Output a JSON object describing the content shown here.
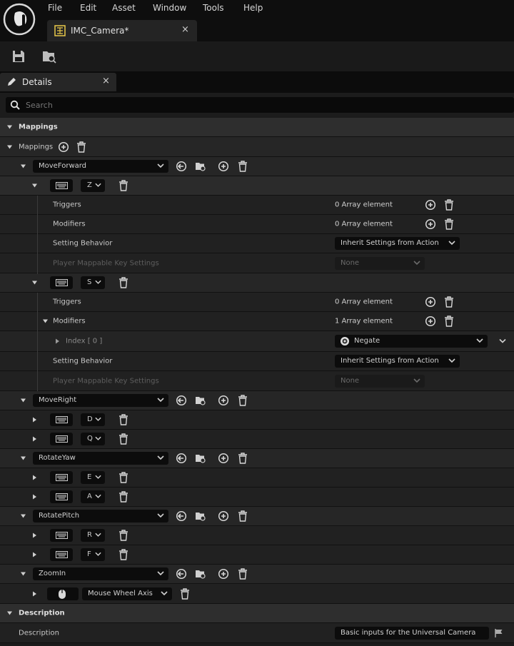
{
  "menu": [
    "File",
    "Edit",
    "Asset",
    "Window",
    "Tools",
    "Help"
  ],
  "tab": {
    "title": "IMC_Camera*"
  },
  "panel": {
    "title": "Details"
  },
  "search": {
    "placeholder": "Search"
  },
  "sections": {
    "mappings": "Mappings",
    "description": "Description"
  },
  "mappings_label": "Mappings",
  "actions": [
    "MoveForward",
    "MoveRight",
    "RotateYaw",
    "RotatePitch",
    "ZoomIn"
  ],
  "keys": {
    "z": "Z",
    "s": "S",
    "d": "D",
    "q": "Q",
    "e": "E",
    "a": "A",
    "r": "R",
    "f": "F",
    "wheel": "Mouse Wheel Axis"
  },
  "props": {
    "triggers": "Triggers",
    "modifiers": "Modifiers",
    "setting_behavior": "Setting Behavior",
    "player_mappable": "Player Mappable Key Settings",
    "index0": "Index [ 0 ]"
  },
  "values": {
    "zero_elems": "0 Array element",
    "one_elem": "1 Array element",
    "inherit": "Inherit Settings from Action",
    "none": "None",
    "negate": "Negate"
  },
  "description": {
    "label": "Description",
    "value": "Basic inputs for the Universal Camera"
  }
}
